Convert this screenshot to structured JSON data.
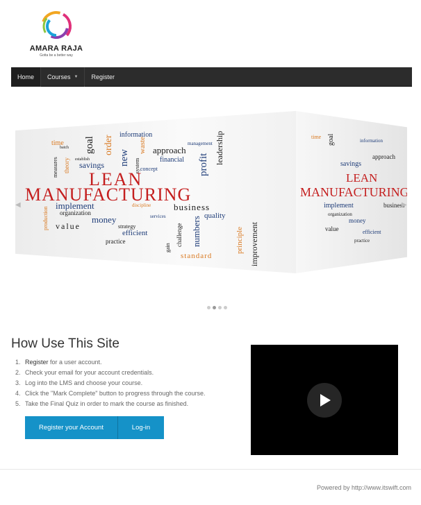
{
  "brand": {
    "name": "AMARA RAJA",
    "tagline": "Gotta be a better way"
  },
  "nav": {
    "items": [
      {
        "label": "Home",
        "active": true
      },
      {
        "label": "Courses",
        "dropdown": true
      },
      {
        "label": "Register"
      }
    ]
  },
  "slider": {
    "word_cloud": {
      "main_words": [
        "LEAN",
        "MANUFACTURING"
      ],
      "words": [
        "time",
        "goal",
        "order",
        "information",
        "management",
        "approach",
        "leadership",
        "waste",
        "new",
        "system",
        "financial",
        "profit",
        "batch",
        "establish",
        "measures",
        "theory",
        "savings",
        "concept",
        "implement",
        "discipline",
        "business",
        "organization",
        "money",
        "services",
        "quality",
        "numbers",
        "production",
        "value",
        "strategy",
        "efficient",
        "challenge",
        "gain",
        "practice",
        "principle",
        "improvement",
        "standard"
      ]
    },
    "dots": 4,
    "active_dot": 1,
    "prev_icon": "arrow-left-icon",
    "next_icon": "arrow-right-icon"
  },
  "how": {
    "title": "How Use This Site",
    "steps": [
      {
        "num": "1.",
        "lead": "Register",
        "text": " for a user account."
      },
      {
        "num": "2.",
        "lead": "",
        "text": "Check your email for your account credentials."
      },
      {
        "num": "3.",
        "lead": "",
        "text": "Log into the LMS and choose your course."
      },
      {
        "num": "4.",
        "lead": "",
        "text": "Click the \"Mark Complete\" button to progress through the course."
      },
      {
        "num": "5.",
        "lead": "",
        "text": "Take the Final Quiz in order to mark the course as finished."
      }
    ],
    "register_button": "Register your Account",
    "login_button": "Log-in"
  },
  "video": {
    "icon": "play-icon"
  },
  "footer": {
    "powered_by": "Powered by http://www.itswift.com"
  },
  "colors": {
    "nav_bg": "#2c2c2c",
    "accent": "#1592c8",
    "cloud_red": "#c41e1e",
    "cloud_blue": "#1e3c78",
    "cloud_orange": "#d9781f"
  }
}
